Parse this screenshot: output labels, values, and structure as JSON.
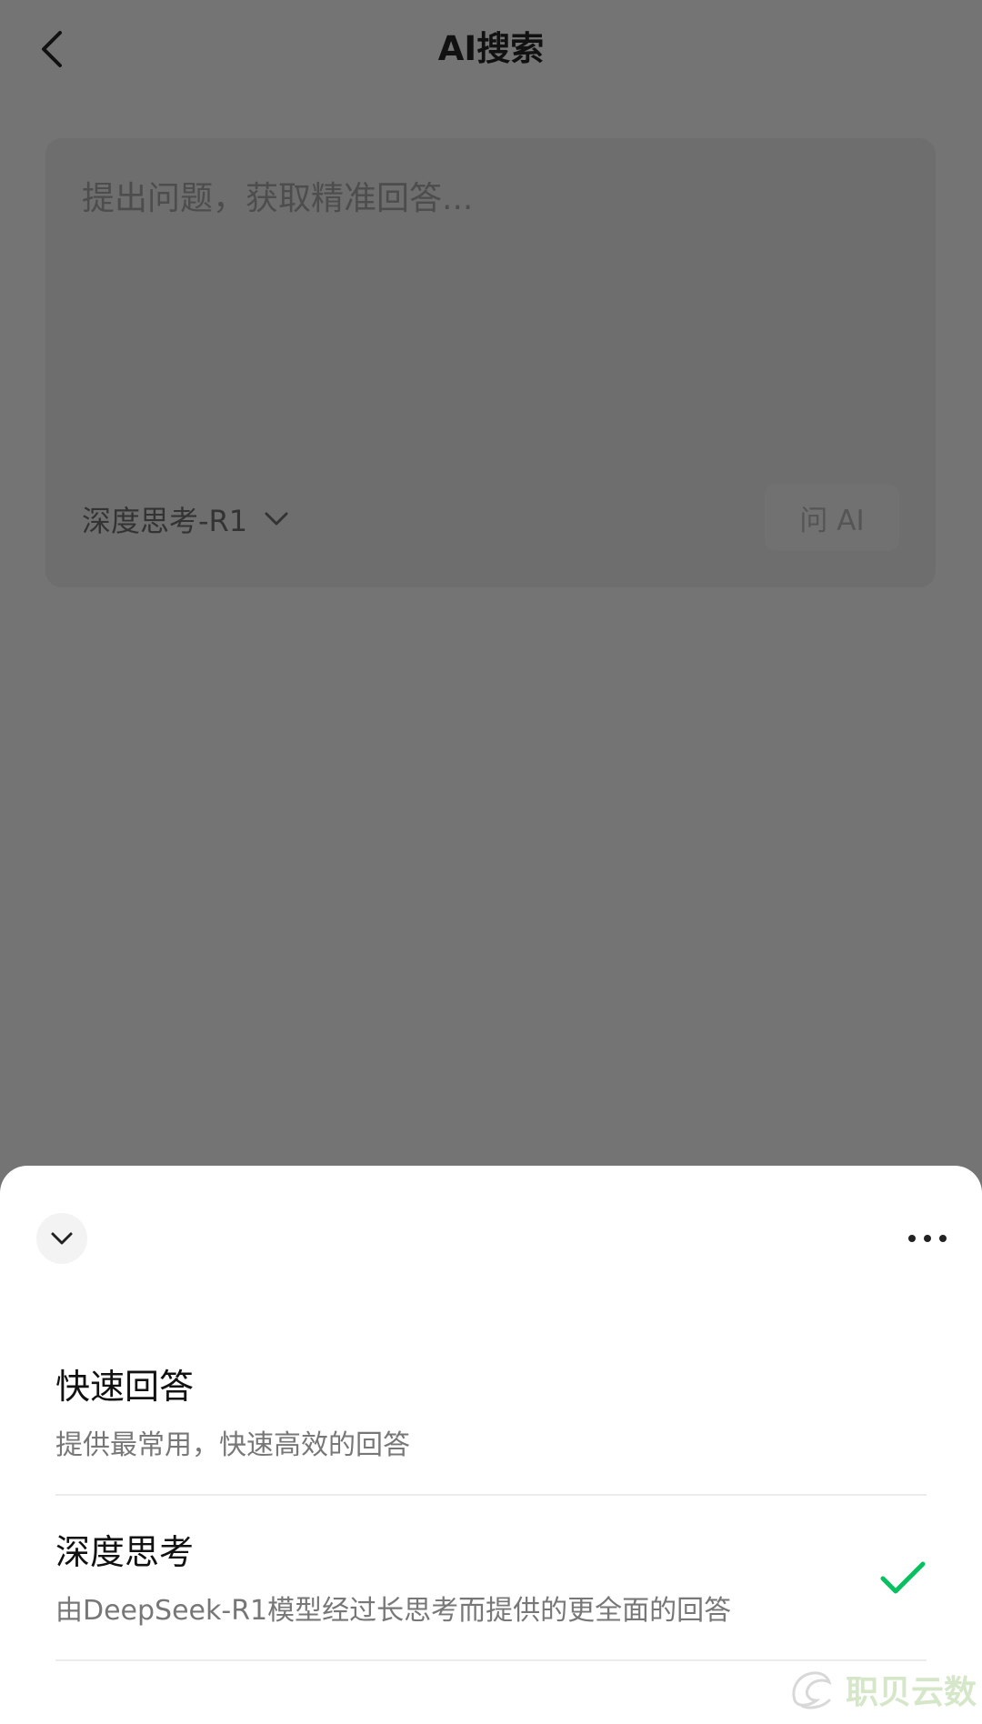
{
  "header": {
    "title": "AI搜索",
    "back_icon": "chevron-left-icon"
  },
  "input_card": {
    "placeholder": "提出问题，获取精准回答...",
    "model_label": "深度思考-R1",
    "model_icon": "chevron-down-icon",
    "ask_label": "问 AI"
  },
  "sheet": {
    "collapse_icon": "chevron-down-icon",
    "more_icon": "more-horizontal-icon",
    "options": [
      {
        "title": "快速回答",
        "desc": "提供最常用，快速高效的回答",
        "selected": false
      },
      {
        "title": "深度思考",
        "desc": "由DeepSeek-R1模型经过长思考而提供的更全面的回答",
        "selected": true
      }
    ]
  },
  "watermark": {
    "text": "职贝云数"
  },
  "colors": {
    "overlay": "#747474",
    "check": "#07c160",
    "watermark": "#d5e7c8"
  }
}
